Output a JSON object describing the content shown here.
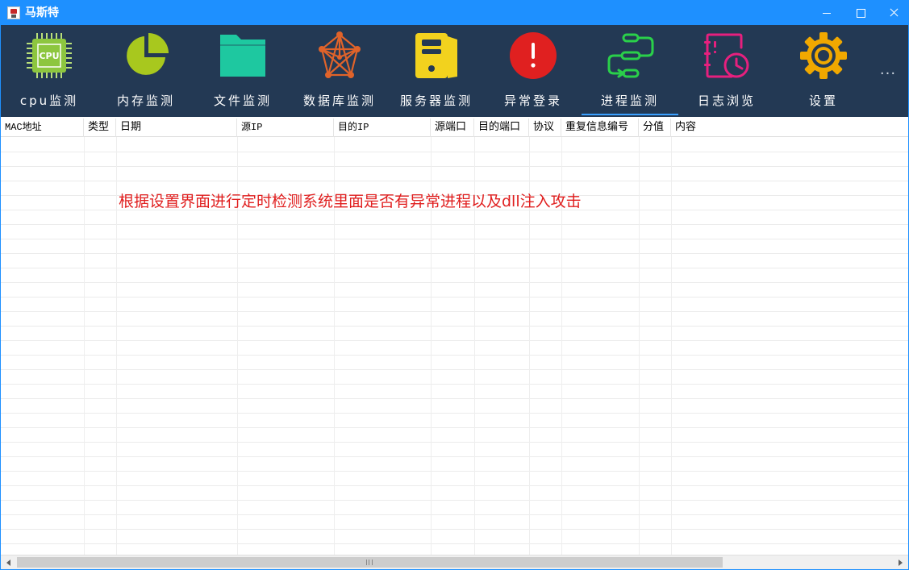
{
  "window": {
    "title": "马斯特",
    "controls": {
      "minimize": "minimize",
      "maximize": "maximize",
      "close": "close"
    },
    "titlebar_color": "#1e90ff"
  },
  "toolbar": {
    "background": "#233954",
    "active_underline_color": "#3aa0ff",
    "items": [
      {
        "label": "cpu监测",
        "icon": "cpu-chip-icon",
        "color": "#8dc63f"
      },
      {
        "label": "内存监测",
        "icon": "pie-chart-icon",
        "color": "#a8c81e"
      },
      {
        "label": "文件监测",
        "icon": "folder-icon",
        "color": "#1ec8a0"
      },
      {
        "label": "数据库监测",
        "icon": "network-graph-icon",
        "color": "#e0632a"
      },
      {
        "label": "服务器监测",
        "icon": "server-icon",
        "color": "#f2d21e"
      },
      {
        "label": "异常登录",
        "icon": "alert-circle-icon",
        "color": "#e02020"
      },
      {
        "label": "进程监测",
        "icon": "process-flow-icon",
        "color": "#2ad04a",
        "active": true
      },
      {
        "label": "日志浏览",
        "icon": "log-clock-icon",
        "color": "#e6207e"
      },
      {
        "label": "设置",
        "icon": "gear-icon",
        "color": "#f0a800"
      }
    ],
    "more": "..."
  },
  "table": {
    "columns": [
      "MAC地址",
      "类型",
      "日期",
      "源IP",
      "目的IP",
      "源端口",
      "目的端口",
      "协议",
      "重复信息编号",
      "分值",
      "内容"
    ],
    "rows": []
  },
  "hint": "根据设置界面进行定时检测系统里面是否有异常进程以及dll注入攻击"
}
